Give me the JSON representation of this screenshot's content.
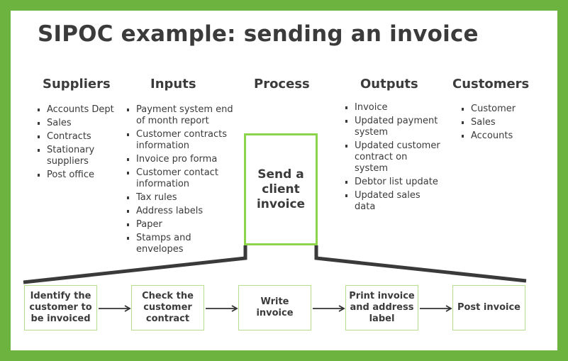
{
  "title": "SIPOC example: sending an invoice",
  "columns": {
    "suppliers": {
      "heading": "Suppliers",
      "items": [
        "Accounts Dept",
        "Sales",
        "Contracts",
        "Stationary suppliers",
        "Post office"
      ]
    },
    "inputs": {
      "heading": "Inputs",
      "items": [
        "Payment system end of month report",
        "Customer contracts information",
        "Invoice pro forma",
        "Customer contact information",
        "Tax rules",
        "Address labels",
        "Paper",
        "Stamps and envelopes"
      ]
    },
    "process": {
      "heading": "Process",
      "box_text": "Send a client invoice"
    },
    "outputs": {
      "heading": "Outputs",
      "items": [
        "Invoice",
        "Updated payment system",
        "Updated customer contract on system",
        "Debtor list update",
        "Updated sales data"
      ]
    },
    "customers": {
      "heading": "Customers",
      "items": [
        "Customer",
        "Sales",
        "Accounts"
      ]
    }
  },
  "steps": [
    "Identify the customer to be invoiced",
    "Check the customer contract",
    "Write invoice",
    "Print invoice and address label",
    "Post invoice"
  ],
  "colors": {
    "frame": "#6db33f",
    "process_border": "#8cd44a",
    "step_border": "#b5df8f",
    "text": "#3b3b3b"
  }
}
